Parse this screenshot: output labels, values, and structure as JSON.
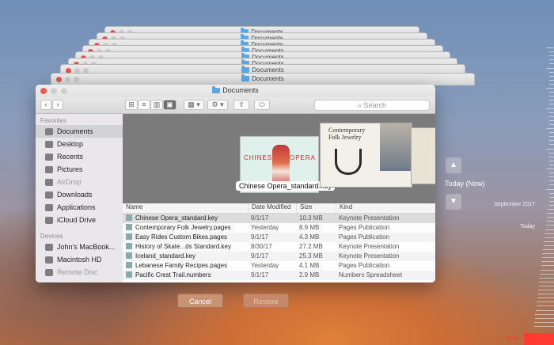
{
  "stack_titles": [
    "Documents",
    "Documents",
    "Documents",
    "Documents",
    "Documents",
    "Documents",
    "Documents",
    "Documents"
  ],
  "window": {
    "title": "Documents",
    "search_placeholder": "Search"
  },
  "sidebar": {
    "favorites_header": "Favorites",
    "favorites": [
      {
        "label": "Documents",
        "icon": "documents-icon",
        "active": true
      },
      {
        "label": "Desktop",
        "icon": "desktop-icon"
      },
      {
        "label": "Recents",
        "icon": "clock-icon"
      },
      {
        "label": "Pictures",
        "icon": "camera-icon"
      },
      {
        "label": "AirDrop",
        "icon": "airdrop-icon",
        "dim": true
      },
      {
        "label": "Downloads",
        "icon": "download-icon"
      },
      {
        "label": "Applications",
        "icon": "applications-icon"
      },
      {
        "label": "iCloud Drive",
        "icon": "cloud-icon"
      }
    ],
    "devices_header": "Devices",
    "devices": [
      {
        "label": "John's MacBook...",
        "icon": "laptop-icon"
      },
      {
        "label": "Macintosh HD",
        "icon": "disk-icon"
      },
      {
        "label": "Remote Disc",
        "icon": "disc-icon",
        "dim": true
      }
    ]
  },
  "preview": {
    "selected_label": "Chinese Opera_standard.key",
    "thumb1_text_left": "CHINESE",
    "thumb1_text_right": "OPERA",
    "thumb2_title": "Contemporary Folk Jewelry"
  },
  "list": {
    "headers": {
      "name": "Name",
      "date": "Date Modified",
      "size": "Size",
      "kind": "Kind"
    },
    "rows": [
      {
        "name": "Chinese Opera_standard.key",
        "date": "9/1/17",
        "size": "10.3 MB",
        "kind": "Keynote Presentation",
        "selected": true
      },
      {
        "name": "Contemporary Folk Jewelry.pages",
        "date": "Yesterday",
        "size": "8.9 MB",
        "kind": "Pages Publication"
      },
      {
        "name": "Easy Rides Custom Bikes.pages",
        "date": "9/1/17",
        "size": "4.3 MB",
        "kind": "Pages Publication"
      },
      {
        "name": "History of Skate...ds Standard.key",
        "date": "8/30/17",
        "size": "27.2 MB",
        "kind": "Keynote Presentation"
      },
      {
        "name": "Iceland_standard.key",
        "date": "9/1/17",
        "size": "25.3 MB",
        "kind": "Keynote Presentation"
      },
      {
        "name": "Lebanese Family Recipes.pages",
        "date": "Yesterday",
        "size": "4.1 MB",
        "kind": "Pages Publication"
      },
      {
        "name": "Pacific Crest Trail.numbers",
        "date": "9/1/17",
        "size": "2.9 MB",
        "kind": "Numbers Spreadsheet"
      }
    ]
  },
  "buttons": {
    "cancel": "Cancel",
    "restore": "Restore"
  },
  "timemachine": {
    "current_label": "Today (Now)",
    "label_sep": "September 2017",
    "label_today": "Today",
    "label_now": "Now",
    "accent": "#ff3b30"
  }
}
